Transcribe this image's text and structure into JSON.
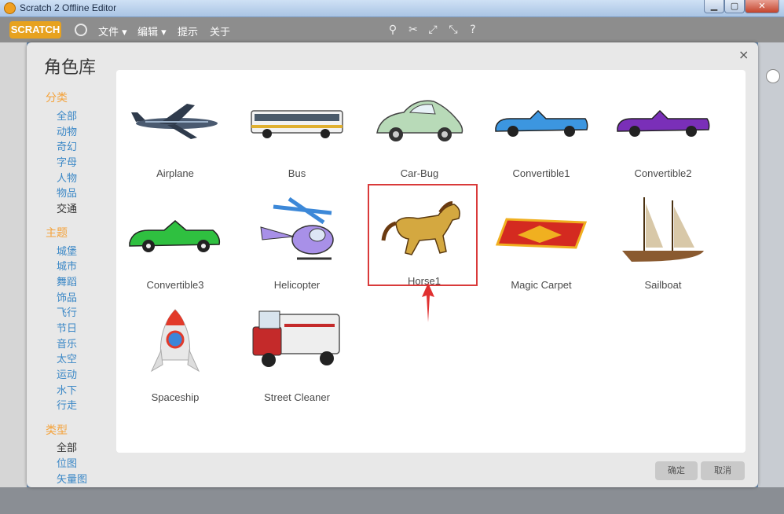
{
  "window": {
    "title": "Scratch 2 Offline Editor"
  },
  "menubar": {
    "logo": "SCRATCH",
    "menus": [
      "文件",
      "编辑",
      "提示",
      "关于"
    ]
  },
  "dialog": {
    "title": "角色库",
    "close": "×",
    "sidebar": {
      "sections": [
        {
          "header": "分类",
          "items": [
            "全部",
            "动物",
            "奇幻",
            "字母",
            "人物",
            "物品",
            "交通"
          ],
          "selected": "交通"
        },
        {
          "header": "主题",
          "items": [
            "城堡",
            "城市",
            "舞蹈",
            "饰品",
            "飞行",
            "节日",
            "音乐",
            "太空",
            "运动",
            "水下",
            "行走"
          ]
        },
        {
          "header": "类型",
          "items": [
            "全部",
            "位图",
            "矢量图"
          ],
          "selected": "全部"
        }
      ]
    },
    "sprites": [
      {
        "name": "Airplane"
      },
      {
        "name": "Bus"
      },
      {
        "name": "Car-Bug"
      },
      {
        "name": "Convertible1"
      },
      {
        "name": "Convertible2"
      },
      {
        "name": "Convertible3"
      },
      {
        "name": "Helicopter"
      },
      {
        "name": "Horse1",
        "highlighted": true
      },
      {
        "name": "Magic Carpet"
      },
      {
        "name": "Sailboat"
      },
      {
        "name": "Spaceship"
      },
      {
        "name": "Street Cleaner"
      }
    ],
    "buttons": {
      "ok": "确定",
      "cancel": "取消"
    }
  },
  "colors": {
    "category_header": "#f4a23a",
    "category_link": "#3a87c6",
    "highlight_border": "#d93a3a"
  }
}
